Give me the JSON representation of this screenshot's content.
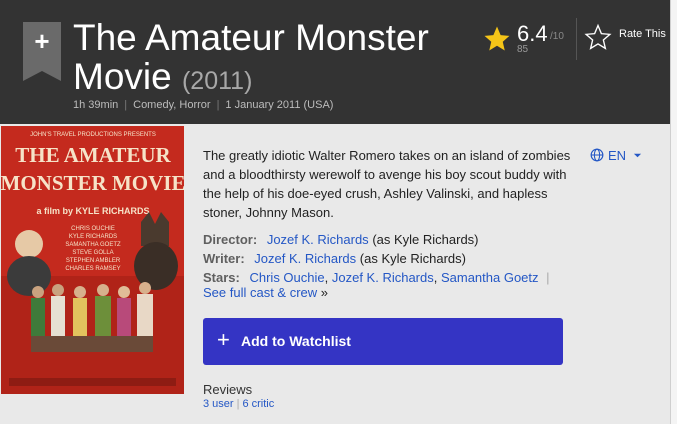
{
  "title": {
    "name": "The Amateur Monster Movie",
    "year": "(2011)"
  },
  "subtext": {
    "runtime": "1h 39min",
    "genres": "Comedy, Horror",
    "release": "1 January 2011 (USA)"
  },
  "rating": {
    "value": "6.4",
    "outof": "/10",
    "count": "85",
    "rate_label": "Rate This"
  },
  "poster": {
    "line1": "JOHN'S TRAVEL PRODUCTIONS PRESENTS",
    "line2": "THE AMATEUR",
    "line3": "MONSTER MOVIE",
    "line4": "a film by KYLE RICHARDS",
    "cast": [
      "CHRIS OUCHIE",
      "KYLE RICHARDS",
      "SAMANTHA GOETZ",
      "STEVE GOLLA",
      "STEPHEN AMBLER",
      "CHARLES RAMSEY"
    ]
  },
  "language": {
    "code": "EN"
  },
  "summary": "The greatly idiotic Walter Romero takes on an island of zombies and a bloodthirsty werewolf to avenge his boy scout buddy with the help of his doe-eyed crush, Ashley Valinski, and hapless stoner, Johnny Mason.",
  "credits": {
    "director_label": "Director:",
    "director_name": "Jozef K. Richards",
    "director_note": "(as Kyle Richards)",
    "writer_label": "Writer:",
    "writer_name": "Jozef K. Richards",
    "writer_note": "(as Kyle Richards)",
    "stars_label": "Stars:",
    "stars": [
      "Chris Ouchie",
      "Jozef K. Richards",
      "Samantha Goetz"
    ],
    "full_cast_label": "See full cast & crew",
    "full_cast_arrow": "»"
  },
  "watchlist": {
    "plus": "+",
    "label": "Add to Watchlist"
  },
  "reviews": {
    "title": "Reviews",
    "user_label": "3 user",
    "critic_label": "6 critic"
  },
  "colors": {
    "header_bg": "#333333",
    "link": "#2457c5",
    "button": "#3434c4",
    "star": "#f5c518"
  }
}
